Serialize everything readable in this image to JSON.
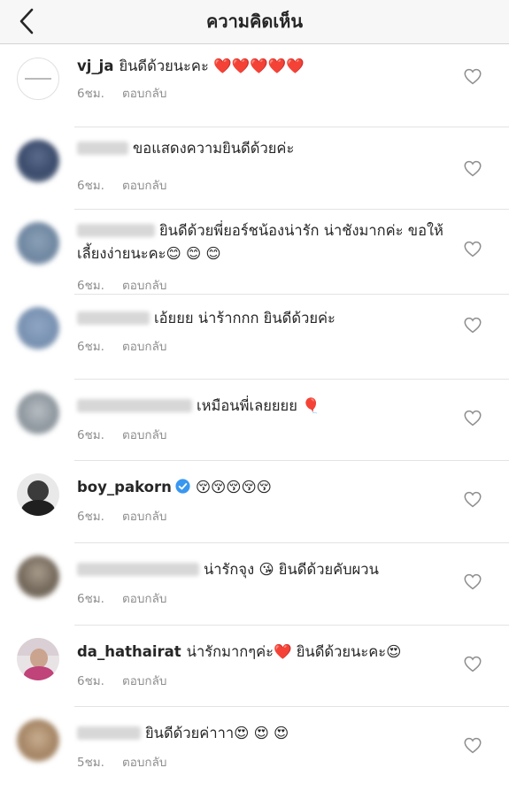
{
  "header": {
    "title": "ความคิดเห็น",
    "back_icon": "chevron-left-icon"
  },
  "comments": [
    {
      "username": "vj_ja",
      "blurred": false,
      "text": "ยินดีด้วยนะคะ ❤️❤️❤️❤️❤️",
      "time": "6ชม.",
      "reply": "ตอบกลับ"
    },
    {
      "username": "",
      "blurred": true,
      "text": "ขอแสดงความยินดีด้วยค่ะ",
      "time": "6ชม.",
      "reply": "ตอบกลับ"
    },
    {
      "username": "",
      "blurred": true,
      "text": "ยินดีด้วยพี่ยอร์ชน้องน่ารัก น่าชังมากค่ะ ขอให้เลี้ยงง่ายนะคะ😊 😊 😊",
      "time": "6ชม.",
      "reply": "ตอบกลับ"
    },
    {
      "username": "",
      "blurred": true,
      "text": "เอ้ยยย น่าร้ากกก ยินดีด้วยค่ะ",
      "time": "6ชม.",
      "reply": "ตอบกลับ"
    },
    {
      "username": "",
      "blurred": true,
      "text": "เหมือนพี่เลยยยย 🎈",
      "time": "6ชม.",
      "reply": "ตอบกลับ"
    },
    {
      "username": "boy_pakorn",
      "blurred": false,
      "verified": true,
      "text": "😚😚😚😚😚",
      "time": "6ชม.",
      "reply": "ตอบกลับ"
    },
    {
      "username": "",
      "blurred": true,
      "text": "น่ารักจุง 😘 ยินดีด้วยคับผวน",
      "time": "6ชม.",
      "reply": "ตอบกลับ"
    },
    {
      "username": "da_hathairat",
      "blurred": false,
      "text": "น่ารักมากๆค่ะ❤️ ยินดีด้วยนะคะ😍",
      "time": "6ชม.",
      "reply": "ตอบกลับ"
    },
    {
      "username": "",
      "blurred": true,
      "text": "ยินดีด้วยค่าาา😍 😍 😍",
      "time": "5ชม.",
      "reply": "ตอบกลับ"
    }
  ]
}
